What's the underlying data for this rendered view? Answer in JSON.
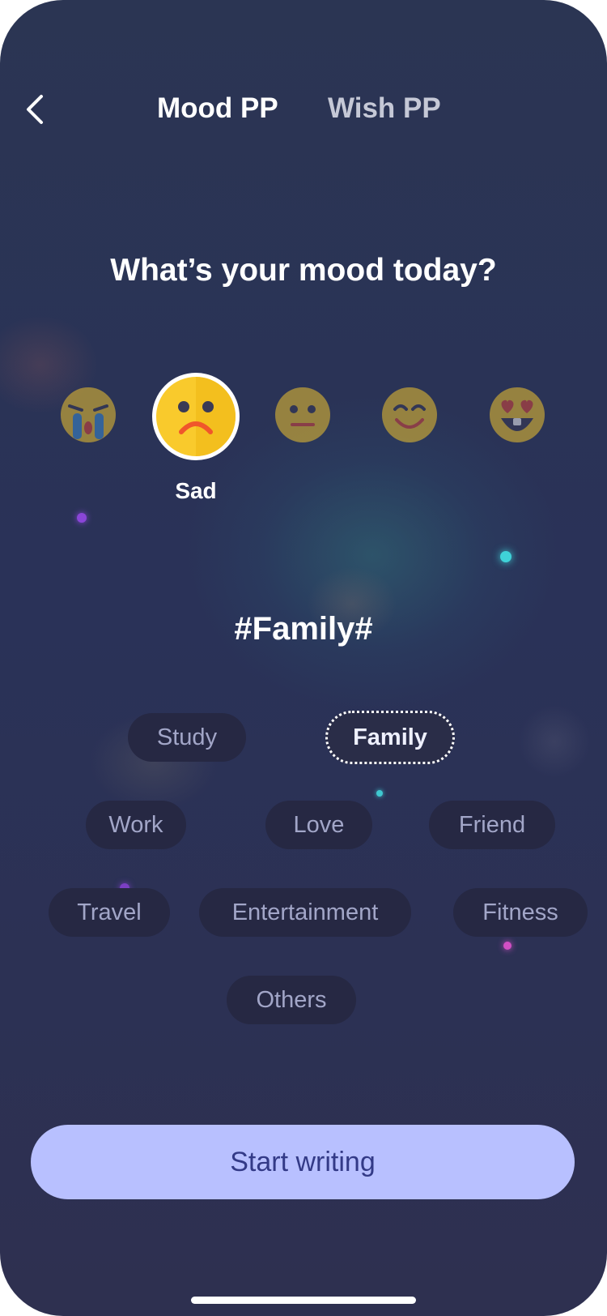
{
  "header": {
    "back_icon": "chevron-left-icon",
    "tabs": [
      {
        "label": "Mood PP",
        "active": true
      },
      {
        "label": "Wish PP",
        "active": false
      }
    ]
  },
  "mood": {
    "question": "What’s your mood today?",
    "options": [
      {
        "icon": "crying-face-icon"
      },
      {
        "icon": "sad-face-icon",
        "selected": true
      },
      {
        "icon": "neutral-face-icon"
      },
      {
        "icon": "smiling-face-icon"
      },
      {
        "icon": "heart-eyes-face-icon"
      }
    ],
    "selected_label": "Sad"
  },
  "topic": {
    "title": "#Family#",
    "tags": [
      "Study",
      "Family",
      "Work",
      "Love",
      "Friend",
      "Travel",
      "Entertainment",
      "Fitness",
      "Others"
    ],
    "selected": "Family"
  },
  "start_button": {
    "label": "Start writing"
  },
  "colors": {
    "background": "#2a3258",
    "tag_background": "#262843",
    "tag_text": "#a2a6c8",
    "button_background": "#b8c0ff",
    "button_text": "#333a87",
    "emoji_yellow": "#f9ca2c"
  }
}
